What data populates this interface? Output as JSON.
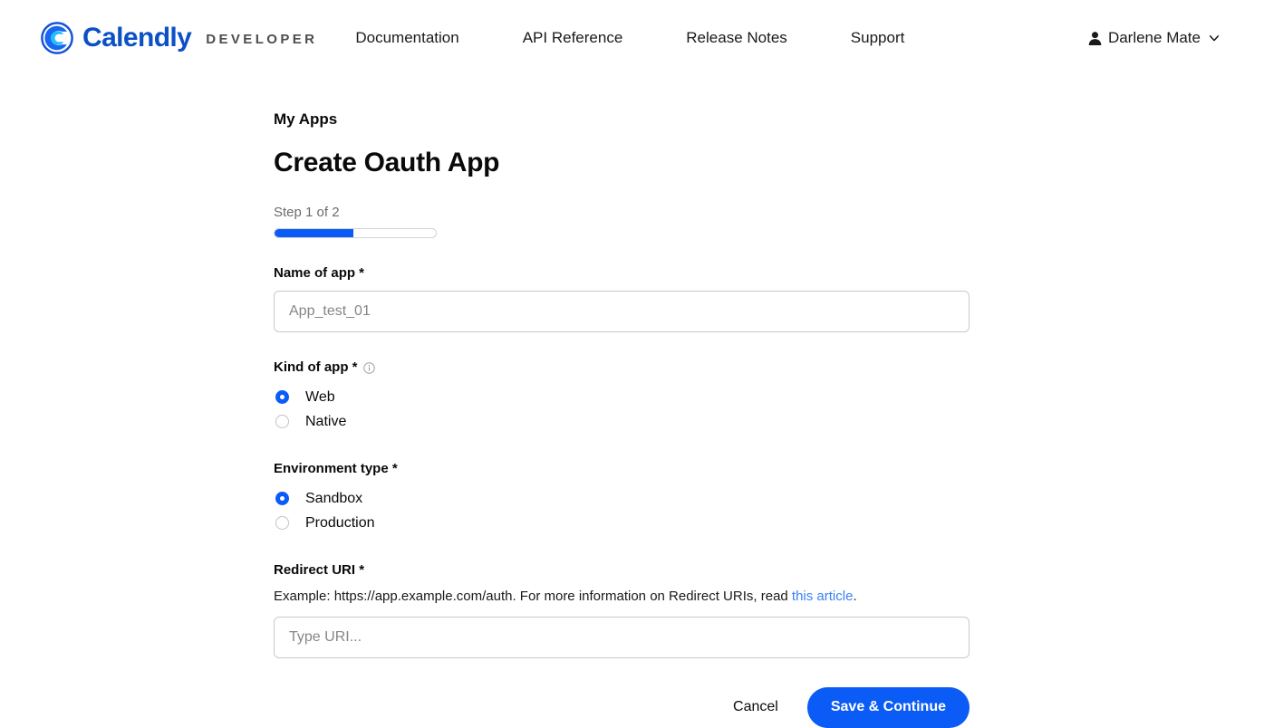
{
  "header": {
    "brand": {
      "logo_icon": "calendly-c-logo-icon",
      "name": "Calendly",
      "subtitle": "DEVELOPER",
      "brand_blue": "#0b51c5",
      "subtitle_color": "#4d4d4d"
    },
    "nav": [
      {
        "label": "Documentation",
        "name": "nav-link-documentation"
      },
      {
        "label": "API Reference",
        "name": "nav-link-api-reference"
      },
      {
        "label": "Release Notes",
        "name": "nav-link-release-notes"
      },
      {
        "label": "Support",
        "name": "nav-link-support"
      }
    ],
    "account": {
      "person_icon": "person-icon",
      "name": "Darlene Mate",
      "chevron_icon": "chevron-down-icon"
    }
  },
  "main": {
    "breadcrumb": "My Apps",
    "title": "Create Oauth App",
    "step": {
      "label": "Step 1 of 2",
      "current": 1,
      "total": 2,
      "percent": 49,
      "fill_color": "#0b5cf6"
    },
    "fields": {
      "name_of_app": {
        "label": "Name of app *",
        "value": "",
        "placeholder": "App_test_01"
      },
      "kind_of_app": {
        "label": "Kind of app *",
        "info_icon": "info-circle-icon",
        "selected": "Web",
        "options": [
          {
            "label": "Web",
            "checked": true
          },
          {
            "label": "Native",
            "checked": false
          }
        ]
      },
      "environment_type": {
        "label": "Environment type *",
        "selected": "Sandbox",
        "options": [
          {
            "label": "Sandbox",
            "checked": true
          },
          {
            "label": "Production",
            "checked": false
          }
        ]
      },
      "redirect_uri": {
        "label": "Redirect URI *",
        "helper_prefix": "Example: https://app.example.com/auth. For more information on Redirect URIs, read ",
        "helper_link": "this article",
        "helper_suffix": ".",
        "link_color": "#3b82f6",
        "value": "",
        "placeholder": "Type URI..."
      }
    },
    "actions": {
      "cancel_label": "Cancel",
      "submit_label": "Save & Continue",
      "submit_color": "#0b5cf6"
    }
  }
}
